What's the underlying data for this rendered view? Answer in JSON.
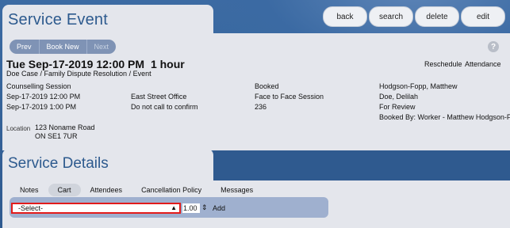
{
  "header": {
    "title": "Service Event",
    "buttons": {
      "back": "back",
      "search": "search",
      "delete": "delete",
      "edit": "edit"
    }
  },
  "nav": {
    "prev": "Prev",
    "book_new": "Book New",
    "next": "Next"
  },
  "help": "?",
  "event": {
    "datetime": "Tue Sep-17-2019 12:00 PM",
    "duration": "1 hour",
    "subtitle": "Doe Case / Family Dispute Resolution / Event",
    "reschedule": "Reschedule",
    "attendance": "Attendance",
    "details": {
      "col1": [
        "Counselling Session",
        "Sep-17-2019 12:00 PM",
        "Sep-17-2019 1:00 PM"
      ],
      "col2": [
        "",
        "East Street Office",
        "Do not call to confirm"
      ],
      "col3": [
        "Booked",
        "Face to Face Session",
        "236"
      ],
      "col4": [
        "Hodgson-Fopp, Matthew",
        "Doe, Delilah",
        "For Review",
        "Booked By: Worker - Matthew Hodgson-F"
      ]
    },
    "location_label": "Location",
    "location_line1": "123 Noname Road",
    "location_line2": "ON SE1 7UR"
  },
  "service_details": {
    "title": "Service Details",
    "tabs": [
      "Notes",
      "Cart",
      "Attendees",
      "Cancellation Policy",
      "Messages"
    ],
    "active_tab": "Cart",
    "select_value": "-Select-",
    "quantity": "1.00",
    "add_label": "Add"
  },
  "colors": {
    "accent": "#2d5a8e",
    "background": "#2f5a8f",
    "panel": "#e4e6ec",
    "highlight": "#e21b1b"
  }
}
